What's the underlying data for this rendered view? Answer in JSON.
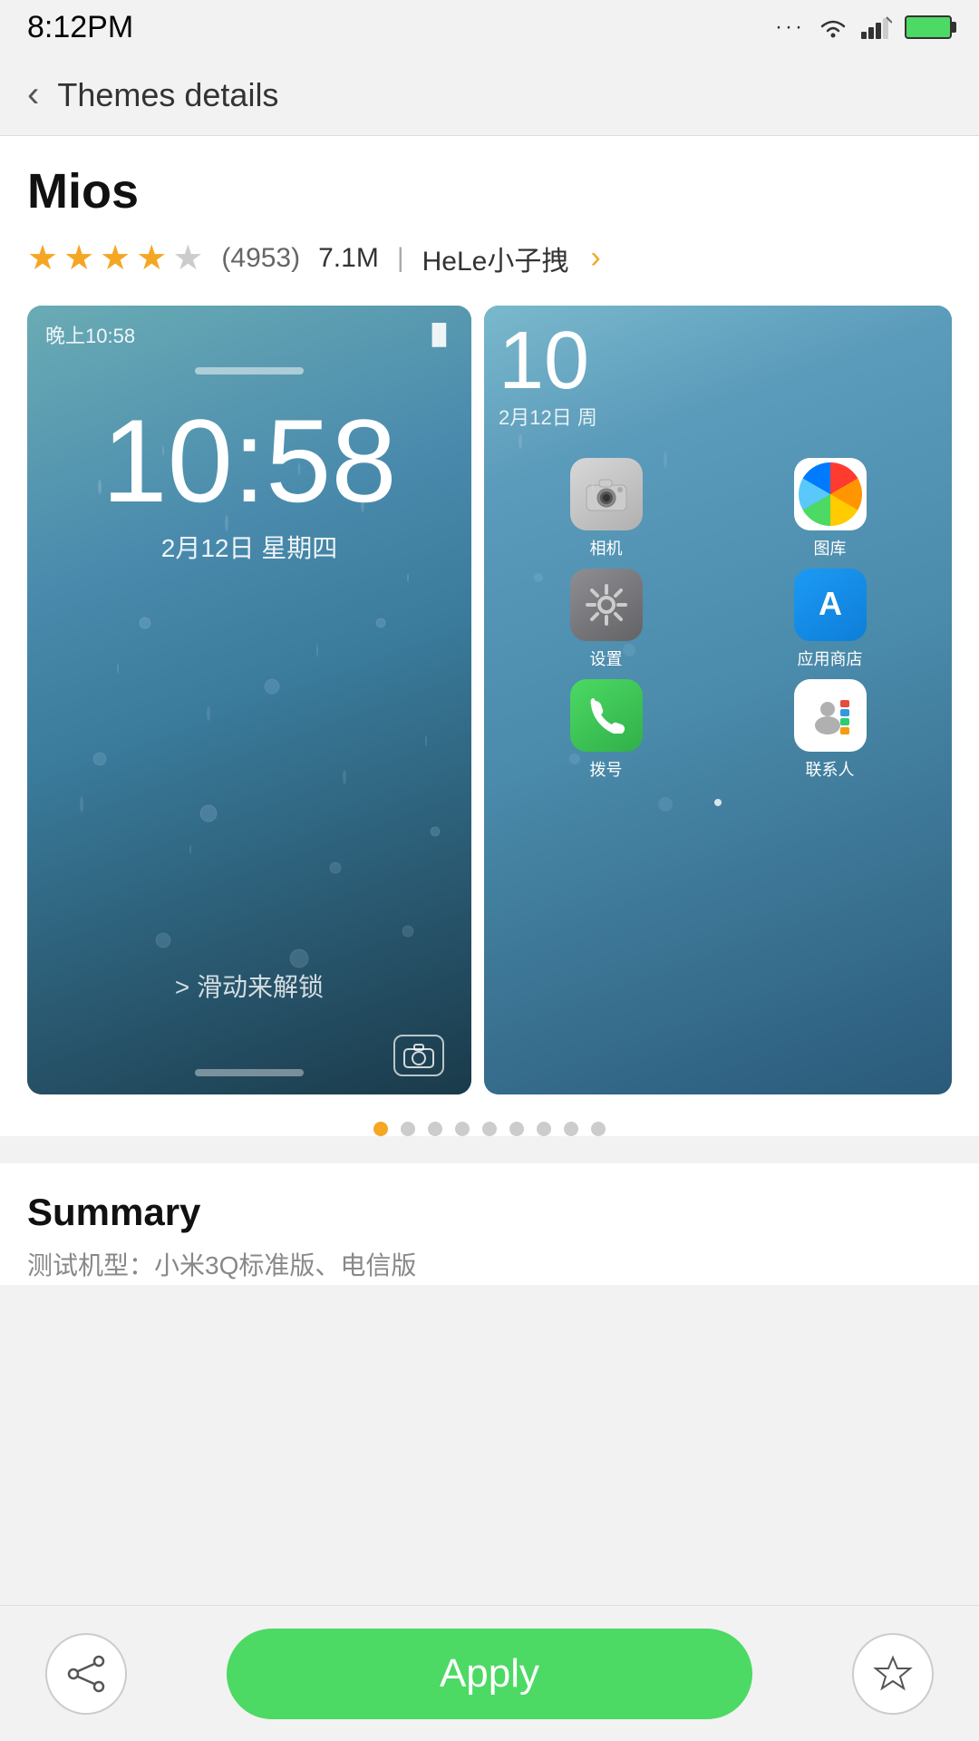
{
  "statusBar": {
    "time": "8:12PM",
    "battery": "●●●",
    "wifi": "wifi",
    "signal": "signal"
  },
  "nav": {
    "backLabel": "‹",
    "title": "Themes details"
  },
  "theme": {
    "name": "Mios",
    "stars": [
      true,
      true,
      true,
      true,
      false
    ],
    "reviewCount": "(4953)",
    "fileSize": "7.1M",
    "author": "HeLe小子拽",
    "lockscreen": {
      "statusTime": "晚上10:58",
      "timeBig": "10:58",
      "date": "2月12日 星期四",
      "slideText": "> 滑动来解锁"
    },
    "homescreen": {
      "time": "10",
      "date": "2月12日 周",
      "apps": [
        {
          "icon": "camera",
          "label": "相机"
        },
        {
          "icon": "photos",
          "label": "图库"
        },
        {
          "icon": "settings",
          "label": "设置"
        },
        {
          "icon": "appstore",
          "label": "应用商店"
        },
        {
          "icon": "phone",
          "label": "拨号"
        },
        {
          "icon": "contacts",
          "label": "联系人"
        }
      ]
    },
    "carouselDots": 9,
    "activeSlide": 0
  },
  "summary": {
    "title": "Summary",
    "text": "测试机型：小米3Q标准版、电信版"
  },
  "bottomBar": {
    "shareIcon": "⑃",
    "applyLabel": "Apply",
    "favoriteIcon": "★"
  }
}
